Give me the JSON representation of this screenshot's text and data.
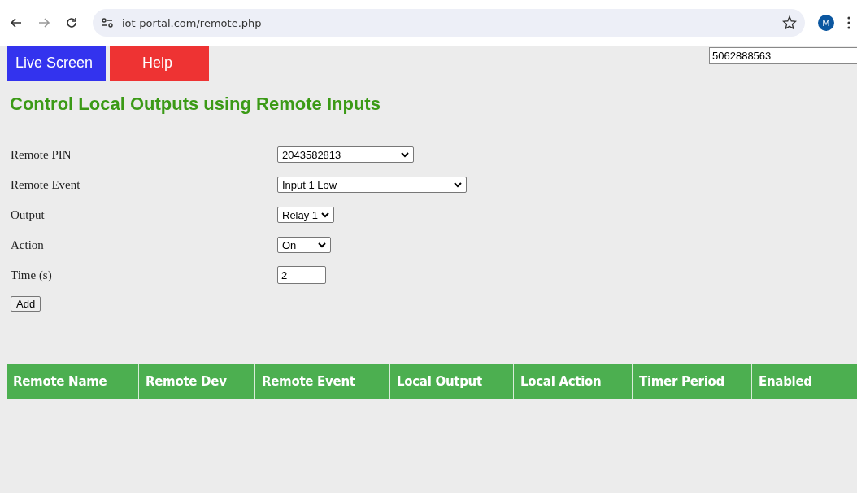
{
  "browser": {
    "url": "iot-portal.com/remote.php",
    "bookmarked": false,
    "profile_initial": "M"
  },
  "nav": [
    {
      "label": "Live Screen",
      "color": "#3333ee"
    },
    {
      "label": "Help",
      "color": "#ee3333"
    }
  ],
  "phone_field": {
    "value": "5062888563"
  },
  "title": "Control Local Outputs using Remote Inputs",
  "form": [
    {
      "label": "Remote PIN",
      "kind": "select",
      "value": "2043582813"
    },
    {
      "label": "Remote Event",
      "kind": "select",
      "value": "Input 1 Low"
    },
    {
      "label": "Output",
      "kind": "select",
      "value": "Relay 1"
    },
    {
      "label": "Action",
      "kind": "select",
      "value": "On"
    },
    {
      "label": "Time (s)",
      "kind": "input",
      "value": "2"
    }
  ],
  "add_button": "Add",
  "table": {
    "columns": [
      "Remote Name",
      "Remote Dev",
      "Remote Event",
      "Local Output",
      "Local Action",
      "Timer Period",
      "Enabled"
    ]
  }
}
